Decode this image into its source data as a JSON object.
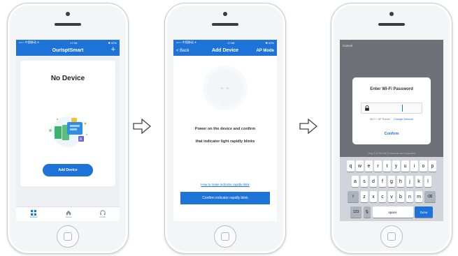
{
  "phone1": {
    "status_left": "••○○ 中国移动 ✈",
    "status_time": "17:08",
    "status_right": "✱ 62%",
    "title": "OurIsptSmart",
    "add_icon": "plus-icon",
    "empty_title": "No Device",
    "add_device_label": "Add Device",
    "tabs": [
      {
        "label": "Devices",
        "icon": "grid-icon"
      },
      {
        "label": "Scene",
        "icon": "home-icon"
      },
      {
        "label": "Profile",
        "icon": "headset-icon"
      }
    ]
  },
  "phone2": {
    "status_left": "••○○ 中国移动 ✈",
    "status_time": "17:08",
    "status_right": "✱ 60%",
    "back_label": "< Back",
    "title": "Add Device",
    "mode_label": "AP Mode",
    "instruction_line1": "Power on the device and confirm",
    "instruction_line2": "that indicator light rapidly blinks",
    "help_link": "How to make indicator rapidly blink",
    "confirm_label": "Confirm indicator rapidly blink"
  },
  "phone3": {
    "cancel_label": "Cancel",
    "dialog_title": "Enter Wi-Fi Password",
    "wifi_label": "Wi-Fi : AP Router",
    "change_network": "Change Network",
    "confirm_label": "Confirm",
    "hint": "Only 2.4 GHz Wi-Fi networks are supported",
    "keyboard": {
      "row1": [
        "q",
        "w",
        "e",
        "r",
        "t",
        "y",
        "u",
        "i",
        "o",
        "p"
      ],
      "row2": [
        "a",
        "s",
        "d",
        "f",
        "g",
        "h",
        "j",
        "k",
        "l"
      ],
      "row3": [
        "z",
        "x",
        "c",
        "v",
        "b",
        "n",
        "m"
      ],
      "shift": "⇧",
      "delete": "⌫",
      "numbers": "123",
      "mic": "🎙",
      "space": "space",
      "done": "Done"
    }
  },
  "colors": {
    "brand_blue": "#1e73d8",
    "dim_overlay": "#6e7177",
    "keyboard_bg": "#d1d5db"
  }
}
